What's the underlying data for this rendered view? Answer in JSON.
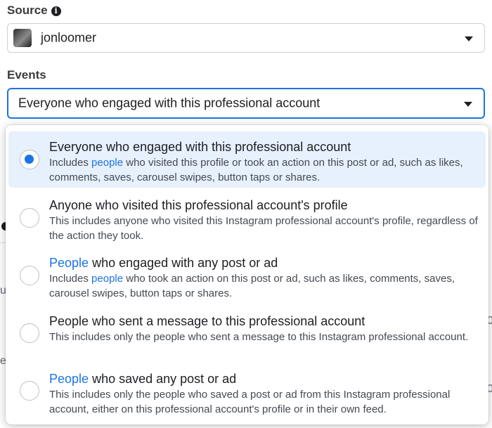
{
  "source": {
    "label": "Source",
    "info_icon": "info-icon",
    "account_name": "jonloomer"
  },
  "events": {
    "label": "Events",
    "selected_value": "Everyone who engaged with this professional account"
  },
  "menu": {
    "options": [
      {
        "title": "Everyone who engaged with this professional account",
        "desc_pre": "Includes ",
        "desc_link": "people",
        "desc_post": " who visited this profile or took an action on this post or ad, such as likes, comments, saves, carousel swipes, button taps or shares.",
        "selected": true
      },
      {
        "title": "Anyone who visited this professional account's profile",
        "desc": "This includes anyone who visited this Instagram professional account's profile, regardless of the action they took.",
        "selected": false
      },
      {
        "title_link": "People",
        "title_rest": " who engaged with any post or ad",
        "desc_pre": "Includes ",
        "desc_link": "people",
        "desc_post": " who took an action on this post or ad, such as likes, comments, saves, carousel swipes, button taps or shares.",
        "selected": false
      },
      {
        "title": "People who sent a message to this professional account",
        "desc": "This includes only the people who sent a message to this Instagram professional account.",
        "selected": false
      },
      {
        "title_link": "People",
        "title_rest": " who saved any post or ad",
        "desc": "This includes only the people who saved a post or ad from this Instagram professional account, either on this professional account's profile or in their own feed.",
        "selected": false
      }
    ]
  },
  "background": {
    "frag_u": "u",
    "frag_e": "e",
    "frag_0a": "0",
    "frag_0b": "0"
  },
  "colors": {
    "accent": "#1b74e4",
    "selected_bg": "#e7f0fd"
  }
}
